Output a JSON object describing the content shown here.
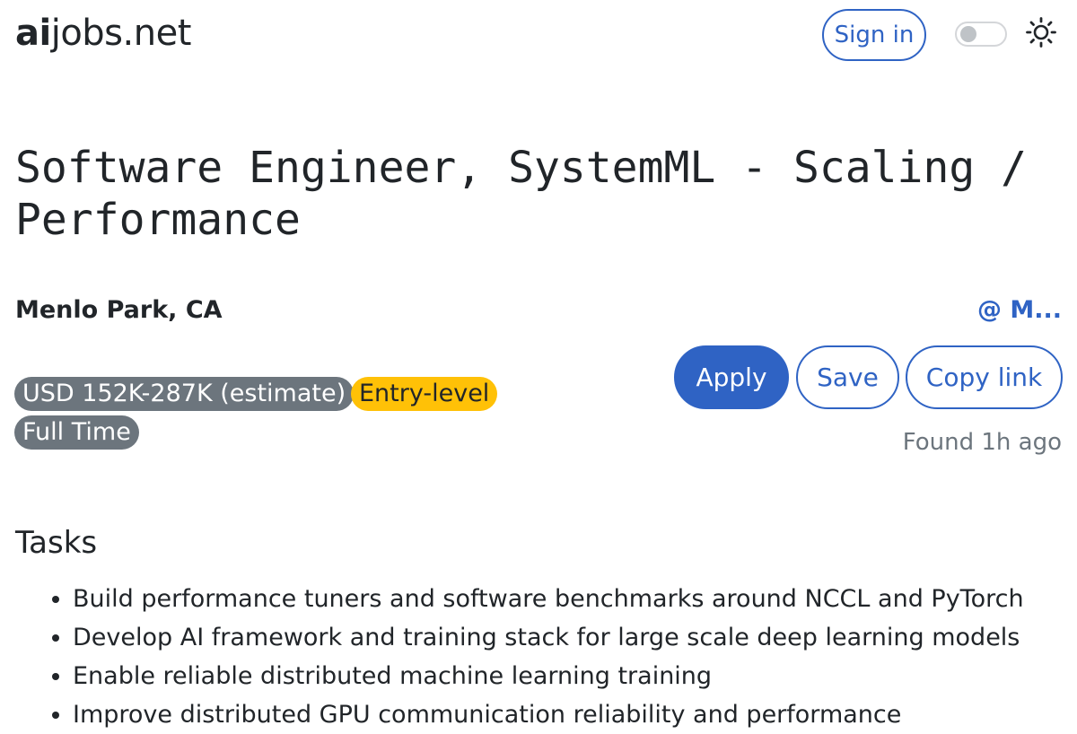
{
  "header": {
    "logo_bold": "ai",
    "logo_rest": "jobs.net",
    "signin_label": "Sign in",
    "theme_toggle": "off",
    "theme_icon": "sun-icon"
  },
  "job": {
    "title": "Software Engineer, SystemML - Scaling / Performance",
    "location": "Menlo Park, CA",
    "company": "@ M...",
    "badges": {
      "salary": "USD 152K-287K (estimate)",
      "level": "Entry-level",
      "type": "Full Time"
    },
    "actions": {
      "apply": "Apply",
      "save": "Save",
      "copy": "Copy link"
    },
    "found": "Found 1h ago"
  },
  "tasks": {
    "heading": "Tasks",
    "items": [
      "Build performance tuners and software benchmarks around NCCL and PyTorch",
      "Develop AI framework and training stack for large scale deep learning models",
      "Enable reliable distributed machine learning training",
      "Improve distributed GPU communication reliability and performance"
    ]
  },
  "colors": {
    "primary": "#2f63c4",
    "badge_gray": "#6c757d",
    "badge_yellow": "#ffc107",
    "text": "#212529",
    "muted": "#6c757d"
  }
}
